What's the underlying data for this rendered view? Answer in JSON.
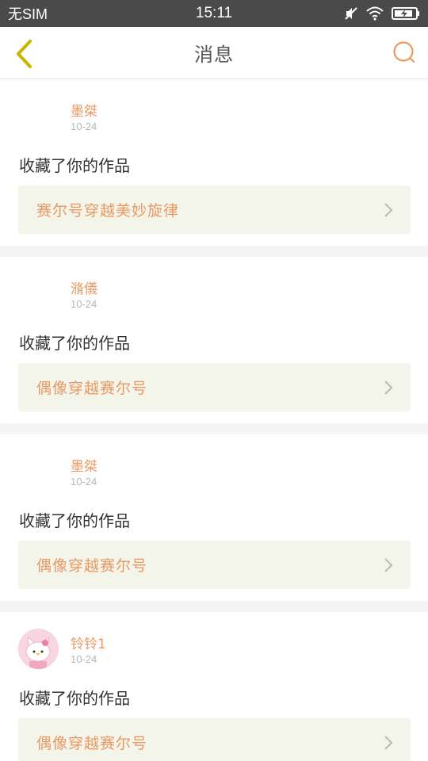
{
  "status_bar": {
    "carrier": "无SIM",
    "time": "15:11",
    "icons": [
      "mute-icon",
      "wifi-icon",
      "battery-charging-icon"
    ]
  },
  "nav": {
    "back_icon": "chevron-left-icon",
    "title": "消息",
    "search_icon": "search-icon"
  },
  "colors": {
    "accent": "#e89a63",
    "back_icon": "#c9b400",
    "status_bar": "#4a4a4a",
    "link_background": "#f3f4ea"
  },
  "messages": [
    {
      "user": "墨桀",
      "date": "10-24",
      "action": "收藏了你的作品",
      "work": "赛尔号穿越美妙旋律",
      "has_avatar": false
    },
    {
      "user": "潃儀",
      "date": "10-24",
      "action": "收藏了你的作品",
      "work": "偶像穿越赛尔号",
      "has_avatar": false
    },
    {
      "user": "墨桀",
      "date": "10-24",
      "action": "收藏了你的作品",
      "work": "偶像穿越赛尔号",
      "has_avatar": false
    },
    {
      "user": "铃铃1",
      "date": "10-24",
      "action": "收藏了你的作品",
      "work": "偶像穿越赛尔号",
      "has_avatar": true,
      "avatar_icon": "hello-kitty-avatar"
    }
  ]
}
